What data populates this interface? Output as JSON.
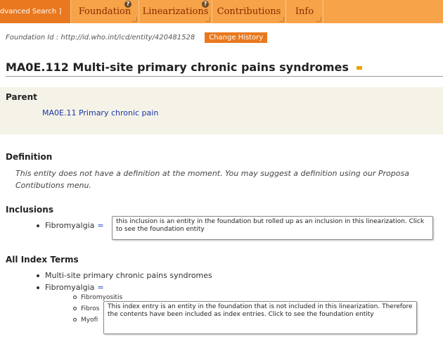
{
  "tabs": [
    {
      "label": "dvanced Search ]"
    },
    {
      "label": "Foundation"
    },
    {
      "label": "Linearizations"
    },
    {
      "label": "Contributions"
    },
    {
      "label": "Info"
    }
  ],
  "help_glyph": "?",
  "foundation": {
    "id_text": "Foundation Id : http://id.who.int/icd/entity/420481528",
    "change_history": "Change History"
  },
  "entity": {
    "title": "MA0E.112 Multi-site primary chronic pains syndromes"
  },
  "parent": {
    "heading": "Parent",
    "link": "MA0E.11 Primary chronic pain"
  },
  "definition": {
    "heading": "Definition",
    "line1": "This entity does not have a definition at the moment. You may suggest a definition using our Proposa",
    "line2": "Contibutions menu."
  },
  "inclusions": {
    "heading": "Inclusions",
    "items": [
      "Fibromyalgia"
    ],
    "tooltip": "this inclusion is an entity in the foundation but rolled up as an inclusion in this linearization. Click to see the foundation entity"
  },
  "index_terms": {
    "heading": "All Index Terms",
    "items": [
      "Multi-site primary chronic pains syndromes",
      "Fibromyalgia"
    ],
    "subitems": [
      "Fibromyositis",
      "Fibros",
      "Myofi"
    ],
    "tooltip": "This index entry is an entity in the foundation that is not included in this linearization. Therefore the contents have been included as index entries. Click to see the foundation entity"
  },
  "eq_glyph": "=",
  "colors": {
    "tabbar": "#f6a349",
    "accent": "#e9781e",
    "link": "#1a34a8"
  }
}
